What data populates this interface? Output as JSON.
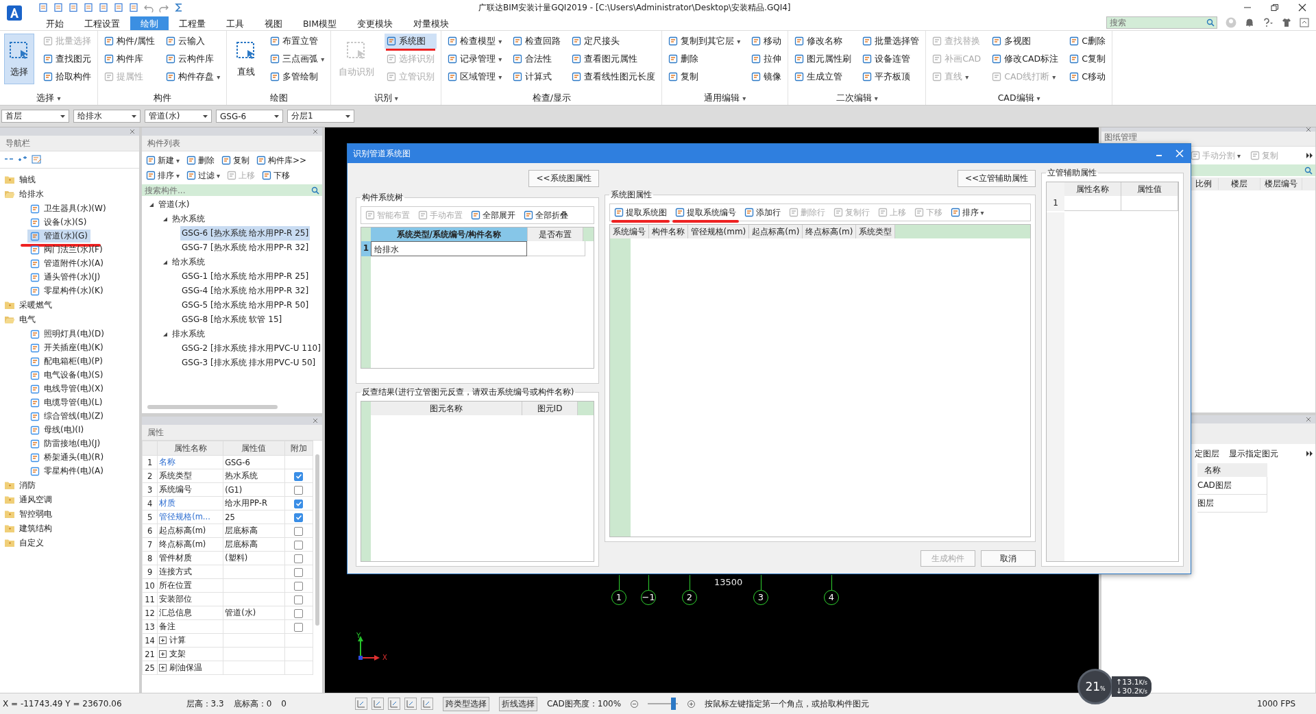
{
  "window": {
    "title": "广联达BIM安装计量GQI2019 - [C:\\Users\\Administrator\\Desktop\\安装精品.GQI4]"
  },
  "tabs": [
    {
      "label": "开始",
      "selected": false
    },
    {
      "label": "工程设置",
      "selected": false
    },
    {
      "label": "绘制",
      "selected": true
    },
    {
      "label": "工程量",
      "selected": false
    },
    {
      "label": "工具",
      "selected": false
    },
    {
      "label": "视图",
      "selected": false
    },
    {
      "label": "BIM模型",
      "selected": false
    },
    {
      "label": "变更模块",
      "selected": false
    },
    {
      "label": "对量模块",
      "selected": false
    }
  ],
  "search": {
    "placeholder": "搜索"
  },
  "ribbon": [
    {
      "label": "选择",
      "caret": "▾",
      "large": [
        {
          "label": "选择",
          "selected": true,
          "disabled": false,
          "marked": false
        }
      ],
      "columns": [
        [
          {
            "label": "批量选择",
            "selected": false,
            "disabled": true,
            "marked": false
          },
          {
            "label": "查找图元",
            "selected": false,
            "disabled": false,
            "marked": false
          },
          {
            "label": "拾取构件",
            "selected": false,
            "disabled": false,
            "marked": false
          }
        ]
      ]
    },
    {
      "label": "构件",
      "columns": [
        [
          {
            "label": "构件/属性",
            "selected": false,
            "disabled": false,
            "marked": false
          },
          {
            "label": "构件库",
            "selected": false,
            "disabled": false,
            "marked": false
          },
          {
            "label": "提属性",
            "selected": false,
            "disabled": true,
            "marked": false
          }
        ],
        [
          {
            "label": "云输入",
            "selected": false,
            "disabled": false,
            "marked": false
          },
          {
            "label": "云构件库",
            "selected": false,
            "disabled": false,
            "marked": false
          },
          {
            "label": "构件存盘",
            "caret": "▾",
            "selected": false,
            "disabled": false,
            "marked": false
          }
        ]
      ]
    },
    {
      "label": "绘图",
      "large": [
        {
          "label": "直线",
          "selected": false,
          "disabled": false,
          "marked": false
        }
      ],
      "columns": [
        [
          {
            "label": "布置立管",
            "selected": false,
            "disabled": false,
            "marked": false
          },
          {
            "label": "三点画弧",
            "caret": "▾",
            "selected": false,
            "disabled": false,
            "marked": false
          },
          {
            "label": "多管绘制",
            "selected": false,
            "disabled": false,
            "marked": false
          }
        ]
      ]
    },
    {
      "label": "识别",
      "caret": "▾",
      "large": [
        {
          "label": "自动识别",
          "selected": false,
          "disabled": true,
          "marked": false
        }
      ],
      "columns": [
        [
          {
            "label": "系统图",
            "selected": true,
            "disabled": false,
            "marked": true
          },
          {
            "label": "选择识别",
            "selected": false,
            "disabled": true,
            "marked": false
          },
          {
            "label": "立管识别",
            "selected": false,
            "disabled": true,
            "marked": false
          }
        ]
      ]
    },
    {
      "label": "检查/显示",
      "columns": [
        [
          {
            "label": "检查模型",
            "caret": "▾",
            "selected": false,
            "disabled": false,
            "marked": false
          },
          {
            "label": "记录管理",
            "caret": "▾",
            "selected": false,
            "disabled": false,
            "marked": false
          },
          {
            "label": "区域管理",
            "caret": "▾",
            "selected": false,
            "disabled": false,
            "marked": false
          }
        ],
        [
          {
            "label": "检查回路",
            "selected": false,
            "disabled": false,
            "marked": false
          },
          {
            "label": "合法性",
            "selected": false,
            "disabled": false,
            "marked": false
          },
          {
            "label": "计算式",
            "selected": false,
            "disabled": false,
            "marked": false
          }
        ],
        [
          {
            "label": "定尺接头",
            "selected": false,
            "disabled": false,
            "marked": false
          },
          {
            "label": "查看图元属性",
            "selected": false,
            "disabled": false,
            "marked": false
          },
          {
            "label": "查看线性图元长度",
            "selected": false,
            "disabled": false,
            "marked": false
          }
        ]
      ]
    },
    {
      "label": "通用编辑",
      "caret": "▾",
      "columns": [
        [
          {
            "label": "复制到其它层",
            "caret": "▾",
            "selected": false,
            "disabled": false,
            "marked": false
          },
          {
            "label": "删除",
            "selected": false,
            "disabled": false,
            "marked": false
          },
          {
            "label": "复制",
            "selected": false,
            "disabled": false,
            "marked": false
          }
        ],
        [
          {
            "label": "移动",
            "selected": false,
            "disabled": false,
            "marked": false
          },
          {
            "label": "拉伸",
            "selected": false,
            "disabled": false,
            "marked": false
          },
          {
            "label": "镜像",
            "selected": false,
            "disabled": false,
            "marked": false
          }
        ]
      ]
    },
    {
      "label": "二次编辑",
      "caret": "▾",
      "columns": [
        [
          {
            "label": "修改名称",
            "selected": false,
            "disabled": false,
            "marked": false
          },
          {
            "label": "图元属性刷",
            "selected": false,
            "disabled": false,
            "marked": false
          },
          {
            "label": "生成立管",
            "selected": false,
            "disabled": false,
            "marked": false
          }
        ],
        [
          {
            "label": "批量选择管",
            "selected": false,
            "disabled": false,
            "marked": false
          },
          {
            "label": "设备连管",
            "selected": false,
            "disabled": false,
            "marked": false
          },
          {
            "label": "平齐板顶",
            "selected": false,
            "disabled": false,
            "marked": false
          }
        ]
      ]
    },
    {
      "label": "CAD编辑",
      "caret": "▾",
      "columns": [
        [
          {
            "label": "查找替换",
            "selected": false,
            "disabled": true,
            "marked": false
          },
          {
            "label": "补画CAD",
            "selected": false,
            "disabled": true,
            "marked": false
          },
          {
            "label": "直线",
            "caret": "▾",
            "selected": false,
            "disabled": true,
            "marked": false
          }
        ],
        [
          {
            "label": "多视图",
            "selected": false,
            "disabled": false,
            "marked": false
          },
          {
            "label": "修改CAD标注",
            "selected": false,
            "disabled": false,
            "marked": false
          },
          {
            "label": "CAD线打断",
            "caret": "▾",
            "selected": false,
            "disabled": true,
            "marked": false
          }
        ],
        [
          {
            "label": "C删除",
            "selected": false,
            "disabled": false,
            "marked": false
          },
          {
            "label": "C复制",
            "selected": false,
            "disabled": false,
            "marked": false
          },
          {
            "label": "C移动",
            "selected": false,
            "disabled": false,
            "marked": false
          }
        ]
      ]
    }
  ],
  "selectors": [
    "首层",
    "给排水",
    "管道(水)",
    "GSG-6",
    "分层1"
  ],
  "nav": {
    "title": "导航栏",
    "items": [
      {
        "label": "轴线",
        "expanded": false
      },
      {
        "label": "给排水",
        "expanded": true,
        "children": [
          {
            "label": "卫生器具(水)(W)",
            "selected": false,
            "marked": false
          },
          {
            "label": "设备(水)(S)",
            "selected": false,
            "marked": false
          },
          {
            "label": "管道(水)(G)",
            "selected": true,
            "marked": true
          },
          {
            "label": "阀门法兰(水)(F)",
            "selected": false,
            "marked": false
          },
          {
            "label": "管道附件(水)(A)",
            "selected": false,
            "marked": false
          },
          {
            "label": "通头管件(水)(J)",
            "selected": false,
            "marked": false
          },
          {
            "label": "零星构件(水)(K)",
            "selected": false,
            "marked": false
          }
        ]
      },
      {
        "label": "采暖燃气",
        "expanded": false
      },
      {
        "label": "电气",
        "expanded": true,
        "children": [
          {
            "label": "照明灯具(电)(D)",
            "selected": false,
            "marked": false
          },
          {
            "label": "开关插座(电)(K)",
            "selected": false,
            "marked": false
          },
          {
            "label": "配电箱柜(电)(P)",
            "selected": false,
            "marked": false
          },
          {
            "label": "电气设备(电)(S)",
            "selected": false,
            "marked": false
          },
          {
            "label": "电线导管(电)(X)",
            "selected": false,
            "marked": false
          },
          {
            "label": "电缆导管(电)(L)",
            "selected": false,
            "marked": false
          },
          {
            "label": "综合管线(电)(Z)",
            "selected": false,
            "marked": false
          },
          {
            "label": "母线(电)(I)",
            "selected": false,
            "marked": false
          },
          {
            "label": "防雷接地(电)(J)",
            "selected": false,
            "marked": false
          },
          {
            "label": "桥架通头(电)(R)",
            "selected": false,
            "marked": false
          },
          {
            "label": "零星构件(电)(A)",
            "selected": false,
            "marked": false
          }
        ]
      },
      {
        "label": "消防",
        "expanded": false
      },
      {
        "label": "通风空调",
        "expanded": false
      },
      {
        "label": "智控弱电",
        "expanded": false
      },
      {
        "label": "建筑结构",
        "expanded": false
      },
      {
        "label": "自定义",
        "expanded": false
      }
    ]
  },
  "component_list": {
    "title": "构件列表",
    "toolbar": [
      {
        "label": "新建",
        "caret": "▾",
        "disabled": false
      },
      {
        "label": "删除",
        "disabled": false
      },
      {
        "label": "复制",
        "disabled": false
      },
      {
        "label": "构件库>>",
        "disabled": false
      },
      {
        "label": "排序",
        "caret": "▾",
        "disabled": false
      },
      {
        "label": "过滤",
        "caret": "▾",
        "disabled": false
      },
      {
        "label": "上移",
        "disabled": true
      },
      {
        "label": "下移",
        "disabled": false
      }
    ],
    "search_placeholder": "搜索构件...",
    "tree": [
      {
        "label": "管道(水)",
        "expanded": true,
        "children": [
          {
            "label": "热水系统",
            "expanded": true,
            "children": [
              {
                "label": "GSG-6 [热水系统 给水用PP-R 25]",
                "selected": true
              },
              {
                "label": "GSG-7 [热水系统 给水用PP-R 32]",
                "selected": false
              }
            ]
          },
          {
            "label": "给水系统",
            "expanded": true,
            "children": [
              {
                "label": "GSG-1 [给水系统 给水用PP-R 25]",
                "selected": false
              },
              {
                "label": "GSG-4 [给水系统 给水用PP-R 32]",
                "selected": false
              },
              {
                "label": "GSG-5 [给水系统 给水用PP-R 50]",
                "selected": false
              },
              {
                "label": "GSG-8 [给水系统 软管 15]",
                "selected": false
              }
            ]
          },
          {
            "label": "排水系统",
            "expanded": true,
            "children": [
              {
                "label": "GSG-2 [排水系统 排水用PVC-U 110]",
                "selected": false
              },
              {
                "label": "GSG-3 [排水系统 排水用PVC-U 50]",
                "selected": false
              }
            ]
          }
        ]
      }
    ]
  },
  "properties": {
    "title": "属性",
    "columns": [
      "属性名称",
      "属性值",
      "附加"
    ],
    "rows": [
      {
        "num": "1",
        "name": "名称",
        "value": "GSG-6",
        "link": true,
        "kind": "fixed"
      },
      {
        "num": "2",
        "name": "系统类型",
        "value": "热水系统",
        "link": false,
        "kind": "field",
        "checked": true
      },
      {
        "num": "3",
        "name": "系统编号",
        "value": "(G1)",
        "link": false,
        "kind": "field",
        "checked": false
      },
      {
        "num": "4",
        "name": "材质",
        "value": "给水用PP-R",
        "link": true,
        "kind": "field",
        "checked": true
      },
      {
        "num": "5",
        "name": "管径规格(m...",
        "value": "25",
        "link": true,
        "kind": "field",
        "checked": true
      },
      {
        "num": "6",
        "name": "起点标高(m)",
        "value": "层底标高",
        "link": false,
        "kind": "field",
        "checked": false
      },
      {
        "num": "7",
        "name": "终点标高(m)",
        "value": "层底标高",
        "link": false,
        "kind": "field",
        "checked": false
      },
      {
        "num": "8",
        "name": "管件材质",
        "value": "(塑料)",
        "link": false,
        "kind": "field",
        "checked": false
      },
      {
        "num": "9",
        "name": "连接方式",
        "link": false,
        "kind": "field",
        "checked": false
      },
      {
        "num": "10",
        "name": "所在位置",
        "link": false,
        "kind": "field",
        "checked": false
      },
      {
        "num": "11",
        "name": "安装部位",
        "link": false,
        "kind": "field",
        "checked": false
      },
      {
        "num": "12",
        "name": "汇总信息",
        "value": "管道(水)",
        "link": false,
        "kind": "field",
        "checked": false
      },
      {
        "num": "13",
        "name": "备注",
        "link": false,
        "kind": "field",
        "checked": false
      },
      {
        "num": "14",
        "name": "计算",
        "link": false,
        "kind": "group"
      },
      {
        "num": "21",
        "name": "支架",
        "link": false,
        "kind": "group"
      },
      {
        "num": "25",
        "name": "刷油保温",
        "link": false,
        "kind": "group"
      }
    ]
  },
  "canvas": {
    "axis_labels": [
      "1",
      "−1",
      "2",
      "3",
      "4"
    ],
    "dimension": "13500",
    "axis_x": "X",
    "axis_y": "Y"
  },
  "drawing_panel": {
    "title": "图纸管理",
    "toolbar": [
      {
        "label": "手动分割",
        "caret": "▾"
      },
      {
        "label": "复制"
      }
    ],
    "columns": [
      "比例",
      "楼层",
      "楼层编号"
    ]
  },
  "layer_panel": {
    "toolbar": [
      "定图层",
      "显示指定图元"
    ],
    "column": "名称",
    "rows": [
      "CAD图层",
      "图层"
    ]
  },
  "dialog": {
    "title": "识别管道系统图",
    "system_props_button": "<<系统图属性",
    "riser_props_button": "<<立管辅助属性",
    "tree_group": {
      "title": "构件系统树",
      "toolbar": [
        {
          "label": "智能布置",
          "disabled": true
        },
        {
          "label": "手动布置",
          "disabled": true
        },
        {
          "label": "全部展开",
          "disabled": false
        },
        {
          "label": "全部折叠",
          "disabled": false
        }
      ],
      "columns": [
        "系统类型/系统编号/构件名称",
        "是否布置"
      ],
      "rows": [
        {
          "num": "1",
          "name": "给排水"
        }
      ]
    },
    "lookup_group": {
      "title": "反查结果(进行立管图元反查，请双击系统编号或构件名称)",
      "columns": [
        "图元名称",
        "图元ID"
      ]
    },
    "system_group": {
      "title": "系统图属性",
      "toolbar": [
        {
          "label": "提取系统图",
          "disabled": false,
          "marked": true
        },
        {
          "label": "提取系统编号",
          "disabled": false,
          "marked": true
        },
        {
          "label": "添加行",
          "disabled": false,
          "marked": false
        },
        {
          "label": "删除行",
          "disabled": true,
          "marked": false
        },
        {
          "label": "复制行",
          "disabled": true,
          "marked": false
        },
        {
          "label": "上移",
          "disabled": true,
          "marked": false
        },
        {
          "label": "下移",
          "disabled": true,
          "marked": false
        },
        {
          "label": "排序",
          "caret": "▾",
          "disabled": false,
          "marked": false
        }
      ],
      "columns": [
        "系统编号",
        "构件名称",
        "管径规格(mm)",
        "起点标高(m)",
        "终点标高(m)",
        "系统类型"
      ]
    },
    "riser_group": {
      "title": "立管辅助属性",
      "columns": [
        "属性名称",
        "属性值"
      ],
      "rows": [
        "1"
      ]
    },
    "buttons": [
      {
        "label": "生成构件",
        "disabled": true
      },
      {
        "label": "取消",
        "disabled": false
      }
    ]
  },
  "network": {
    "percent": "21",
    "unit": "%",
    "up": "↑13.1",
    "up_unit": "K/s",
    "down": "↓30.2",
    "down_unit": "K/s"
  },
  "status_bar": {
    "coords": "X = -11743.49 Y = 23670.06",
    "floor_height": "层高：3.3",
    "base_height": "底标高：0",
    "value": "0",
    "buttons": [
      "跨类型选择",
      "折线选择"
    ],
    "brightness": "CAD图亮度：100%",
    "level": 0.85,
    "hint": "按鼠标左键指定第一个角点，或拾取构件图元",
    "fps": "1000 FPS"
  }
}
